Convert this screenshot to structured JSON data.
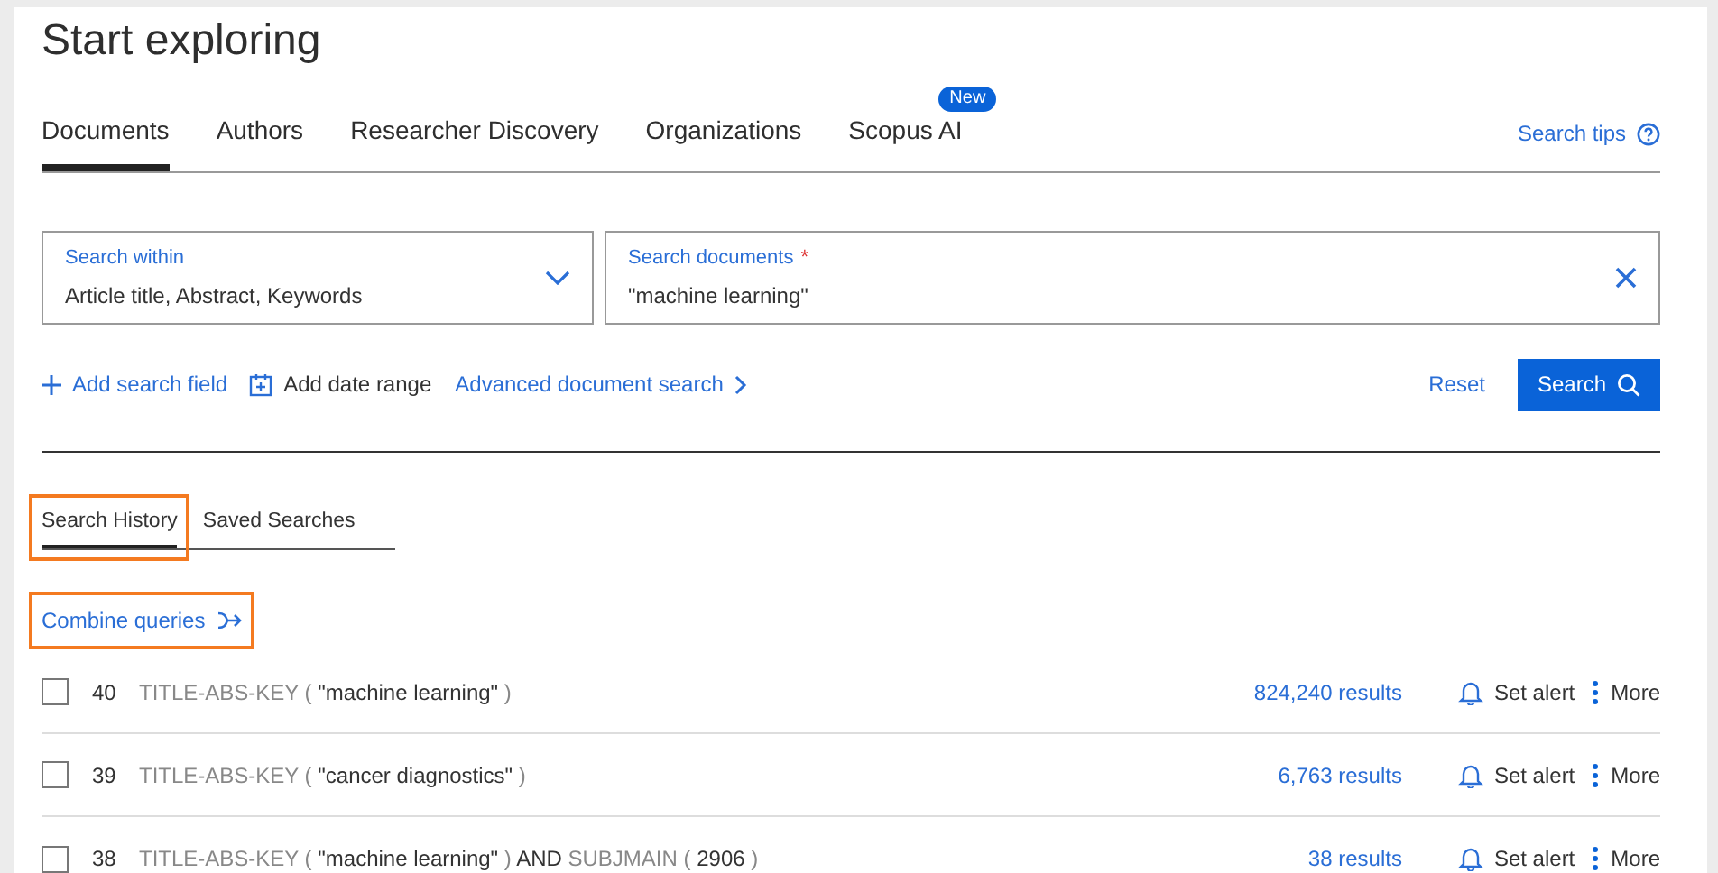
{
  "title": "Start exploring",
  "tabs": [
    {
      "label": "Documents",
      "selected": true
    },
    {
      "label": "Authors",
      "selected": false
    },
    {
      "label": "Researcher Discovery",
      "selected": false
    },
    {
      "label": "Organizations",
      "selected": false
    },
    {
      "label": "Scopus AI",
      "selected": false,
      "badge": "New"
    }
  ],
  "search_tips": "Search tips",
  "search_within": {
    "label": "Search within",
    "value": "Article title, Abstract, Keywords"
  },
  "search_field": {
    "label": "Search documents",
    "required_mark": "*",
    "value": "\"machine learning\""
  },
  "actions": {
    "add_field": "Add search field",
    "add_date": "Add date range",
    "advanced": "Advanced document search",
    "reset": "Reset",
    "search": "Search"
  },
  "history_tabs": [
    {
      "label": "Search History",
      "selected": true,
      "highlighted": true
    },
    {
      "label": "Saved Searches",
      "selected": false,
      "highlighted": false
    }
  ],
  "combine": {
    "label": "Combine queries",
    "highlighted": true
  },
  "history": [
    {
      "checked": false,
      "number": "40",
      "query": [
        {
          "kind": "field",
          "text": "TITLE-ABS-KEY ("
        },
        {
          "kind": "term",
          "text": "\"machine learning\""
        },
        {
          "kind": "field",
          "text": ")"
        }
      ],
      "results": "824,240 results",
      "alert": "Set alert",
      "more": "More"
    },
    {
      "checked": false,
      "number": "39",
      "query": [
        {
          "kind": "field",
          "text": "TITLE-ABS-KEY ("
        },
        {
          "kind": "term",
          "text": "\"cancer diagnostics\""
        },
        {
          "kind": "field",
          "text": ")"
        }
      ],
      "results": "6,763 results",
      "alert": "Set alert",
      "more": "More"
    },
    {
      "checked": false,
      "number": "38",
      "query": [
        {
          "kind": "field",
          "text": "TITLE-ABS-KEY ("
        },
        {
          "kind": "term",
          "text": "\"machine learning\""
        },
        {
          "kind": "field",
          "text": ")"
        },
        {
          "kind": "term",
          "text": "AND"
        },
        {
          "kind": "field",
          "text": "SUBJMAIN ("
        },
        {
          "kind": "term",
          "text": "2906"
        },
        {
          "kind": "field",
          "text": ")"
        }
      ],
      "results": "38 results",
      "alert": "Set alert",
      "more": "More"
    }
  ]
}
